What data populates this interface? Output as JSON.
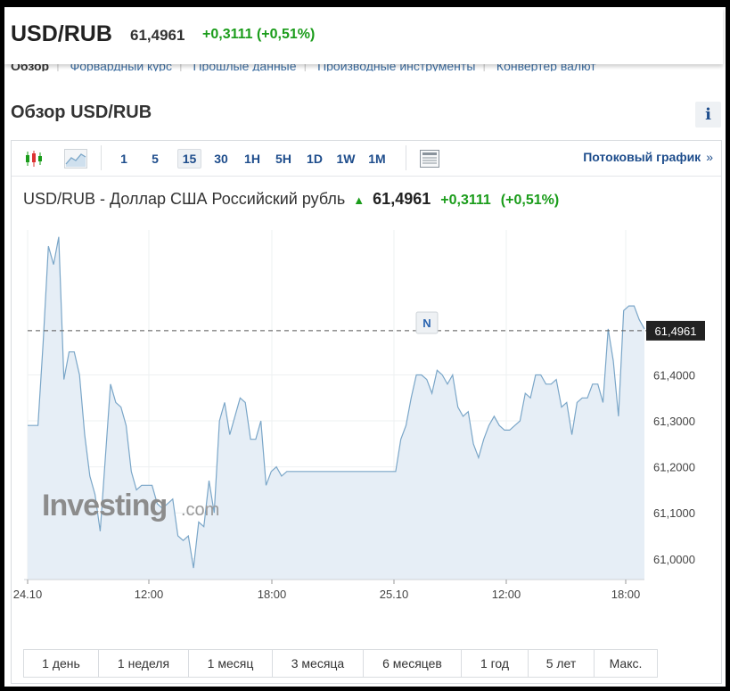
{
  "header": {
    "symbol": "USD/RUB",
    "price": "61,4961",
    "change": "+0,3111 (+0,51%)"
  },
  "subnav": [
    "Обзор",
    "Форвардный курс",
    "Прошлые данные",
    "Производные инструменты",
    "Конвертер валют"
  ],
  "section_title": "Обзор USD/RUB",
  "info_label": "i",
  "toolbar": {
    "intervals": [
      "1",
      "5",
      "15",
      "30",
      "1H",
      "5H",
      "1D",
      "1W",
      "1M"
    ],
    "active_interval": "15",
    "stream_label": "Потоковый график",
    "stream_chevron": "»"
  },
  "quote": {
    "name": "USD/RUB - Доллар США Российский рубль",
    "price": "61,4961",
    "change": "+0,3111",
    "change_pct": "(+0,51%)"
  },
  "ranges": [
    "1 день",
    "1 неделя",
    "1 месяц",
    "3 месяца",
    "6 месяцев",
    "1 год",
    "5 лет",
    "Макс."
  ],
  "watermark": {
    "main": "Investing",
    "suffix": ".com"
  },
  "marker_label": "N",
  "colors": {
    "line": "#7aa6c8",
    "area": "#e6eef6",
    "positive": "#1a9c1a",
    "link": "#1e4d8c"
  },
  "chart_data": {
    "type": "area",
    "title": "USD/RUB - Доллар США Российский рубль",
    "x_ticks": [
      "24.10",
      "12:00",
      "18:00",
      "25.10",
      "12:00",
      "18:00"
    ],
    "y_ticks": [
      "61,0000",
      "61,1000",
      "61,2000",
      "61,3000",
      "61,4000"
    ],
    "ylim": [
      60.955,
      61.715
    ],
    "last_value": 61.4961,
    "last_label": "61,4961",
    "grid": true,
    "values": [
      61.29,
      61.29,
      61.29,
      61.47,
      61.68,
      61.64,
      61.7,
      61.39,
      61.45,
      61.45,
      61.4,
      61.27,
      61.18,
      61.14,
      61.06,
      61.22,
      61.38,
      61.34,
      61.33,
      61.29,
      61.19,
      61.15,
      61.16,
      61.16,
      61.16,
      61.12,
      61.11,
      61.12,
      61.13,
      61.05,
      61.04,
      61.05,
      60.98,
      61.08,
      61.07,
      61.17,
      61.1,
      61.3,
      61.34,
      61.27,
      61.31,
      61.35,
      61.34,
      61.26,
      61.26,
      61.3,
      61.16,
      61.19,
      61.2,
      61.18,
      61.19,
      61.19,
      61.19,
      61.19,
      61.19,
      61.19,
      61.19,
      61.19,
      61.19,
      61.19,
      61.19,
      61.19,
      61.19,
      61.19,
      61.19,
      61.19,
      61.19,
      61.19,
      61.19,
      61.19,
      61.19,
      61.19,
      61.26,
      61.29,
      61.35,
      61.4,
      61.4,
      61.39,
      61.36,
      61.41,
      61.4,
      61.38,
      61.4,
      61.33,
      61.31,
      61.32,
      61.25,
      61.22,
      61.26,
      61.29,
      61.31,
      61.29,
      61.28,
      61.28,
      61.29,
      61.3,
      61.36,
      61.35,
      61.4,
      61.4,
      61.38,
      61.38,
      61.39,
      61.33,
      61.34,
      61.27,
      61.34,
      61.35,
      61.35,
      61.38,
      61.38,
      61.34,
      61.5,
      61.43,
      61.31,
      61.54,
      61.55,
      61.55,
      61.52,
      61.5
    ]
  }
}
